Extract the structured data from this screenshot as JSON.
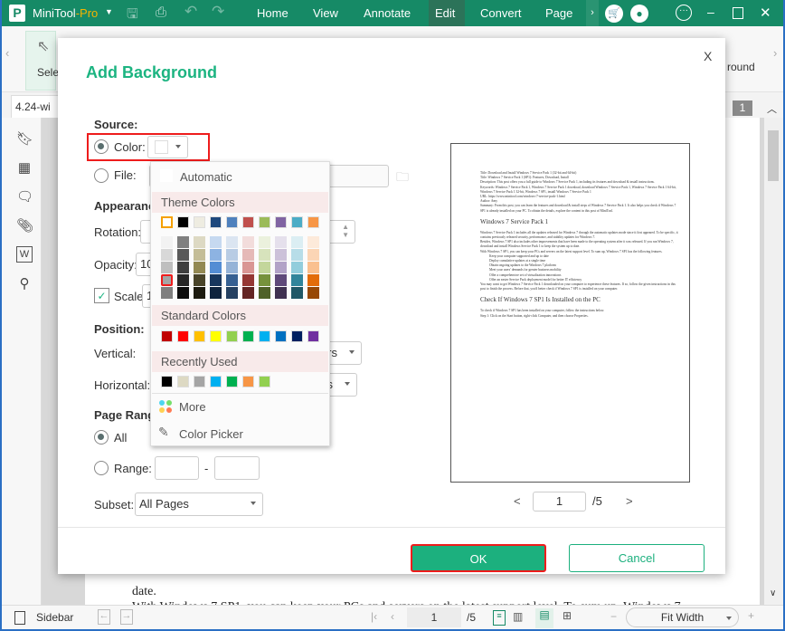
{
  "app": {
    "name": "MiniTool",
    "name_suffix": "-Pro",
    "menus": [
      "Home",
      "View",
      "Annotate",
      "Edit",
      "Convert",
      "Page"
    ],
    "active_menu": "Edit",
    "accent": "#168a66"
  },
  "toolbar": {
    "select_label": "Selec",
    "background_label": "round"
  },
  "tab": {
    "label": "4.24-wi",
    "page_badge": "1"
  },
  "doc_behind": {
    "line1": "date.",
    "line2": "With Windows 7 SP1, you can keep your PCs and servers on the latest support level. To sum up, Windows 7"
  },
  "dialog": {
    "title": "Add Background",
    "source_label": "Source:",
    "color_label": "Color:",
    "file_label": "File:",
    "appearance_label": "Appearance",
    "rotation_label": "Rotation:",
    "opacity_label": "Opacity:",
    "opacity_value": "10",
    "scale_label": "Scale:",
    "scale_value": "1",
    "scale_checked": true,
    "position_label": "Position:",
    "vertical_label": "Vertical:",
    "vertical_value": "rs",
    "horizontal_label": "Horizontal:",
    "horizontal_value": "s",
    "page_range_label": "Page Range",
    "all_label": "All",
    "range_label": "Range:",
    "range_dash": "-",
    "subset_label": "Subset:",
    "subset_value": "All Pages",
    "pager": {
      "prev": "<",
      "current": "1",
      "total": "/5",
      "next": ">"
    },
    "ok_label": "OK",
    "cancel_label": "Cancel",
    "close_label": "X"
  },
  "color_popup": {
    "automatic_label": "Automatic",
    "theme_label": "Theme Colors",
    "theme": [
      "#FFFFFF",
      "#000000",
      "#EEECE1",
      "#1F497D",
      "#4F81BD",
      "#C0504D",
      "#9BBB59",
      "#8064A2",
      "#4BACC6",
      "#F79646"
    ],
    "shades": [
      [
        "#F2F2F2",
        "#D8D8D8",
        "#BFBFBF",
        "#A5A5A5",
        "#7F7F7F"
      ],
      [
        "#7F7F7F",
        "#595959",
        "#3F3F3F",
        "#262626",
        "#0C0C0C"
      ],
      [
        "#DDD9C3",
        "#C4BD97",
        "#938953",
        "#494429",
        "#1D1B10"
      ],
      [
        "#C6D9F0",
        "#8DB3E2",
        "#548DD4",
        "#17365D",
        "#0F243E"
      ],
      [
        "#DBE5F1",
        "#B8CCE4",
        "#95B3D7",
        "#366092",
        "#244061"
      ],
      [
        "#F2DCDB",
        "#E5B9B7",
        "#D99694",
        "#953734",
        "#632423"
      ],
      [
        "#EBF1DD",
        "#D7E3BC",
        "#C3D69B",
        "#76923C",
        "#4F6128"
      ],
      [
        "#E5E0EC",
        "#CCC1D9",
        "#B2A2C7",
        "#5F497A",
        "#3F3151"
      ],
      [
        "#DBEEF3",
        "#B7DDE8",
        "#92CDDC",
        "#31859B",
        "#205867"
      ],
      [
        "#FDEADA",
        "#FBD5B5",
        "#FAC08F",
        "#E36C09",
        "#974806"
      ]
    ],
    "selected_shade": "#A5A5A5",
    "standard_label": "Standard Colors",
    "standard": [
      "#C00000",
      "#FF0000",
      "#FFC000",
      "#FFFF00",
      "#92D050",
      "#00B050",
      "#00B0F0",
      "#0070C0",
      "#002060",
      "#7030A0"
    ],
    "recent_label": "Recently Used",
    "recent": [
      "#000000",
      "#DDD9C3",
      "#A5A5A5",
      "#00B0F0",
      "#00B050",
      "#F79646",
      "#92D050"
    ],
    "more_label": "More",
    "picker_label": "Color Picker"
  },
  "preview": {
    "lines": [
      "Title: Download and Install Windows 7 Service Pack 1 (32-bit and 64-bit)",
      "Title: Windows 7 Service Pack 1 (SP1): Features, Download, Install",
      "Description: This post offers you a full guide to Windows 7 Service Pack 1, including its features and download & install instructions.",
      "Keywords: Windows 7 Service Pack 1, Windows 7 Service Pack 1 download, download Windows 7 Service Pack 1, Windows 7 Service Pack 1 64-bit, Windows 7 Service Pack 1 32-bit, Windows 7 SP1, install Windows 7 Service Pack 1",
      "URL: https://www.minitool.com/windows-7-service-pack-1.html",
      "Author: Amy",
      "Summary: From this post, you can learn the features and download & install steps of Windows 7 Service Pack 1. It also helps you check if Windows 7 SP1 is already installed on your PC. To obtain the details, explore the content in this post of MiniTool."
    ],
    "heading1": "Windows 7 Service Pack 1",
    "para1": "Windows 7 Service Pack 1 includes all the updates released for Windows 7 through the automatic updates mode since it first appeared. To be specific, it contains previously released security, performance, and stability updates for Windows 7.",
    "para2": "Besides, Windows 7 SP1 also includes other improvements that have been made to the operating system after it was released. If you run Windows 7, download and install Windows Service Pack 1 to keep the system up to date.",
    "para3": "With Windows 7 SP1, you can keep your PCs and servers on the latest support level. To sum up, Windows 7 SP1 has the following features.",
    "bullets": [
      "Keep your computer supported and up to date",
      "Deploy cumulative updates at a single time",
      "Obtain ongoing updates to the Windows 7 platform",
      "Meet your users' demands for greater business mobility",
      "Offer a comprehensive set of virtualization innovations",
      "Offer an easier Service Pack deployment model for better IT efficiency"
    ],
    "para4": "You may want to get Windows 7 Service Pack 1 downloaded on your computer to experience these features. If so, follow the given instructions in this post to finish the process. Before that, you'd better check if Windows 7 SP1 is installed on your computer.",
    "heading2": "Check If Windows 7 SP1 Is Installed on the PC",
    "para5": "To check if Windows 7 SP1 has been installed on your computer, follow the instructions below.",
    "para6": "Step 1: Click on the Start button, right-click Computer, and then choose Properties."
  },
  "statusbar": {
    "sidebar_label": "Sidebar",
    "page_current": "1",
    "page_total": "/5",
    "zoom_value": "Fit Width",
    "minus": "−",
    "plus": "+"
  }
}
